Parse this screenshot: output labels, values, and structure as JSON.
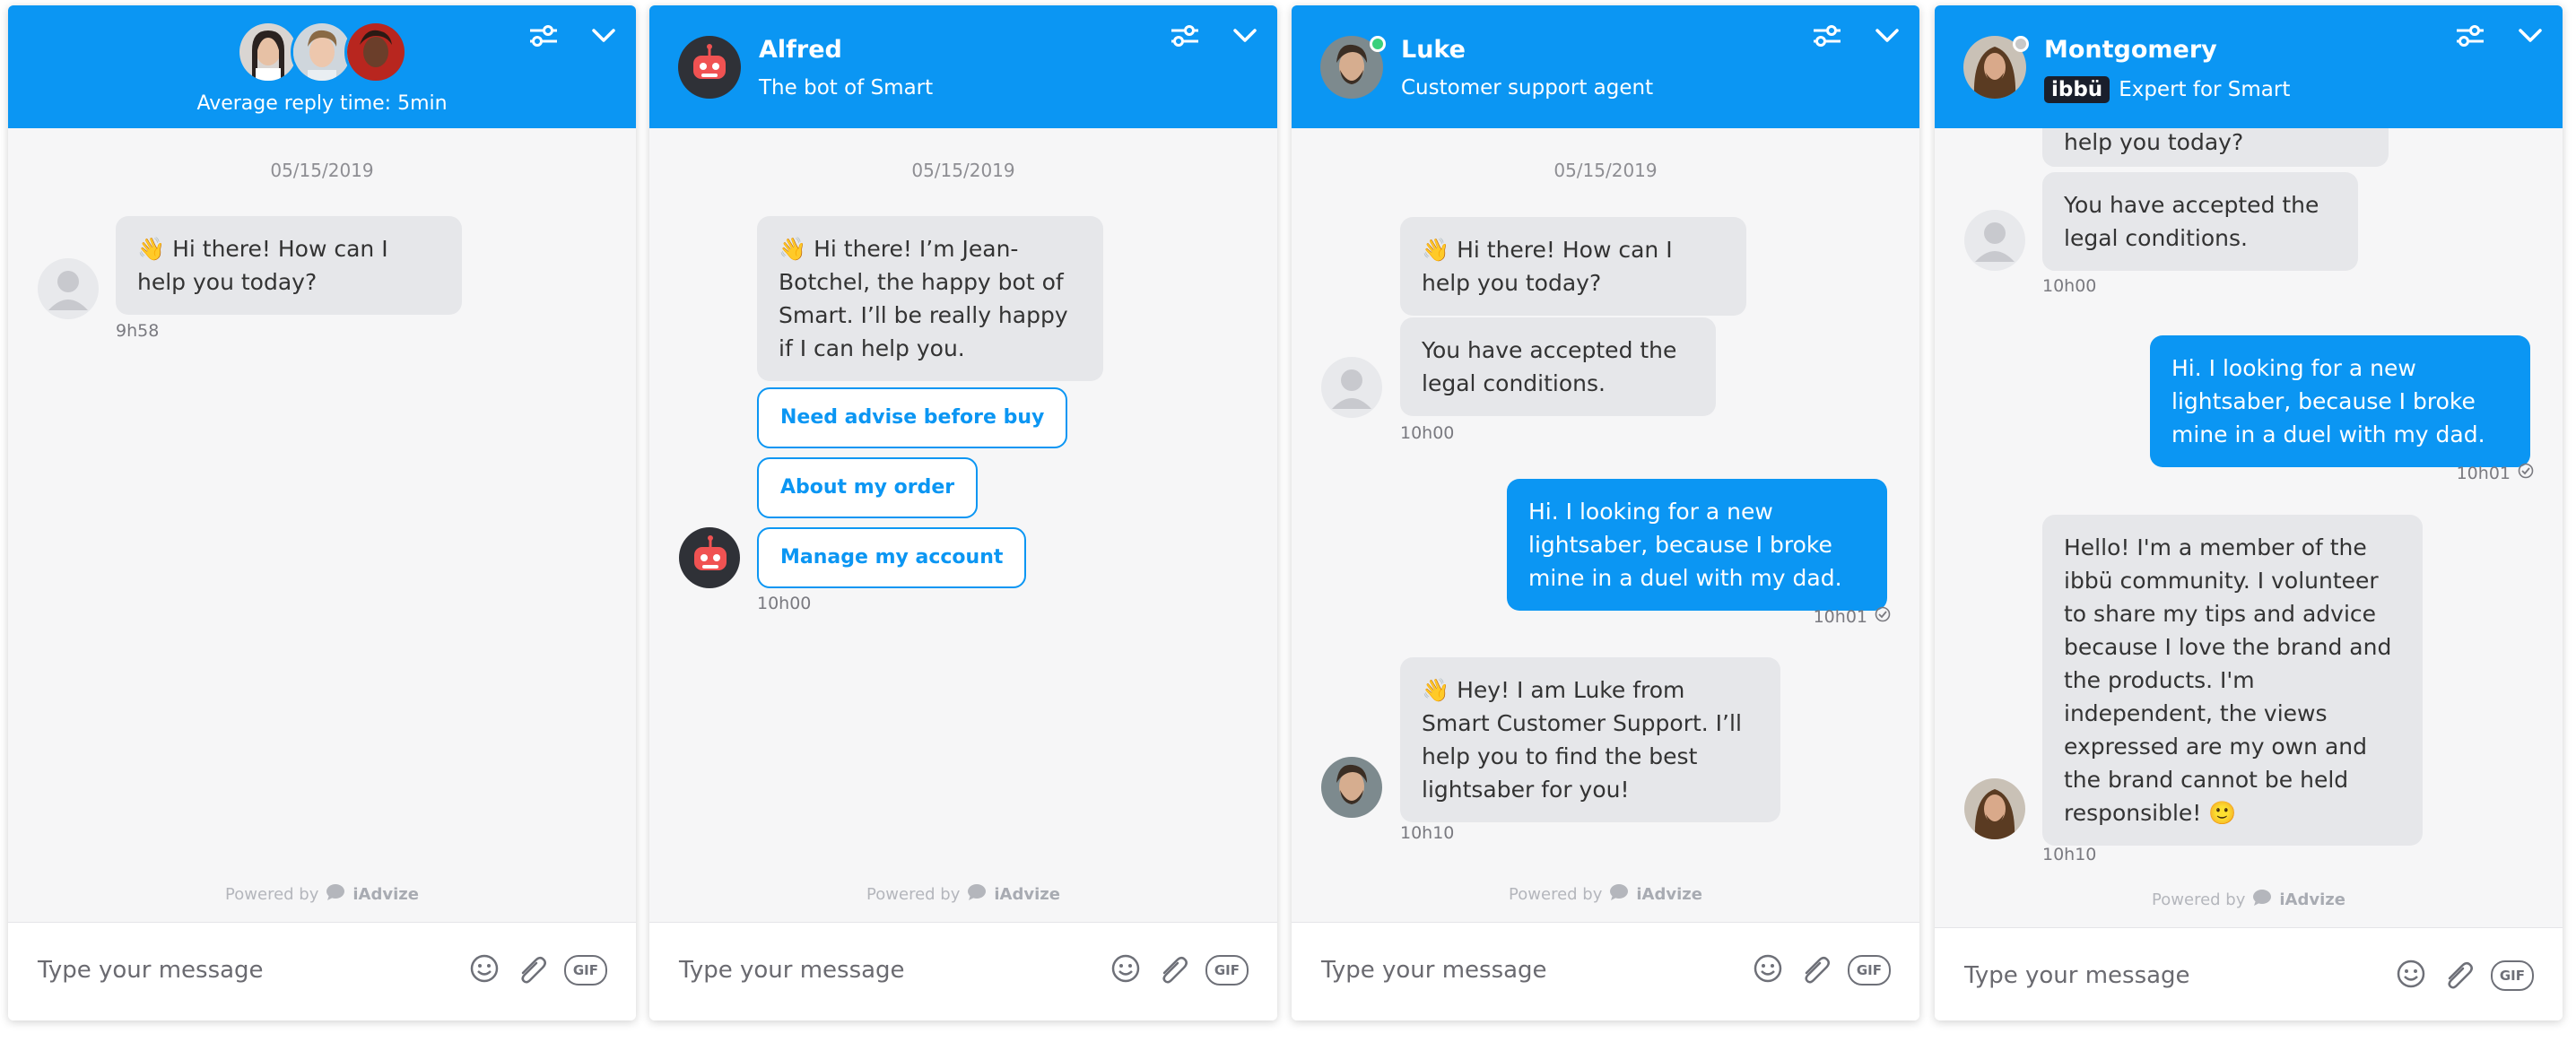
{
  "panels": {
    "team": {
      "reply_time": "Average reply time: 5min",
      "date": "05/15/2019",
      "msg1": "👋 Hi there! How can I help you today?",
      "msg1_time": "9h58"
    },
    "alfred": {
      "name": "Alfred",
      "subtitle": "The bot of Smart",
      "date": "05/15/2019",
      "msg1": "👋 Hi there! I’m Jean-Botchel, the happy bot of Smart. I’ll be really happy if I can help you.",
      "quick_replies": [
        "Need advise before buy",
        "About my order",
        "Manage my account"
      ],
      "msg_time": "10h00"
    },
    "luke": {
      "name": "Luke",
      "subtitle": "Customer support agent",
      "date": "05/15/2019",
      "msg1": "👋 Hi there! How can I help you today?",
      "msg2": "You have accepted the legal conditions.",
      "msg2_time": "10h00",
      "user_msg": "Hi. I looking for a new lightsaber, because I broke mine in a duel with my dad.",
      "user_time": "10h01",
      "msg3": "👋 Hey! I am Luke from Smart Customer Support. I’ll help you to find the best lightsaber for you!",
      "msg3_time": "10h10"
    },
    "montgomery": {
      "name": "Montgomery",
      "badge": "ibbü",
      "subtitle": "Expert for Smart",
      "msg0_tail": "help you today?",
      "msg1": "You have accepted the legal conditions.",
      "msg1_time": "10h00",
      "user_msg": "Hi. I looking for a new lightsaber, because I broke mine in a duel with my dad.",
      "user_time": "10h01",
      "msg2": "Hello! I'm a member of the ibbü community. I volunteer to share my tips and advice because I love the brand and the products. I'm independent, the views expressed are my own and the brand cannot be held responsible! 🙂",
      "msg2_time": "10h10"
    }
  },
  "common": {
    "powered_by": "Powered by",
    "brand": "iAdvize",
    "composer_placeholder": "Type your message",
    "gif_label": "GIF"
  },
  "colors": {
    "accent": "#0b96f3",
    "bubble_grey": "#e6e7ea",
    "online": "#3ad07c"
  }
}
